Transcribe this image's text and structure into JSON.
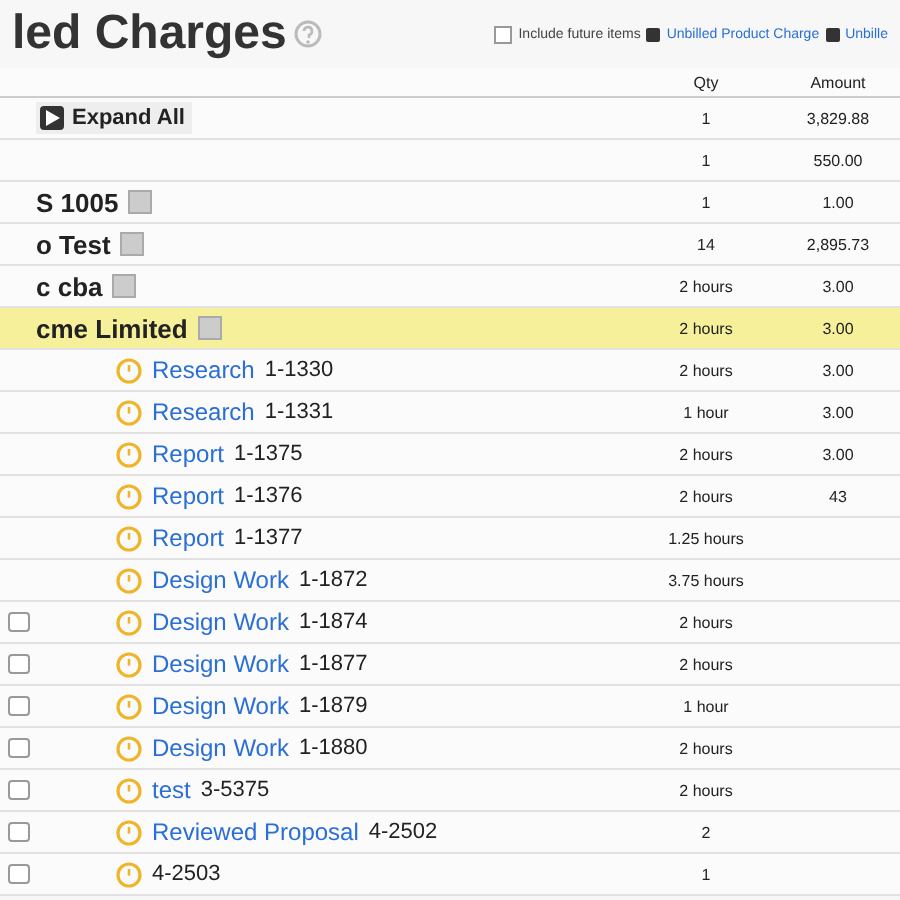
{
  "title": "led Charges",
  "toolbar": {
    "include_label": "Include future items",
    "include_checked": false,
    "link_1": "Unbilled Product Charge",
    "link_2": "Unbille"
  },
  "columns": [
    "Qty",
    "Amount"
  ],
  "expand": {
    "label": "Expand All",
    "qty": "1",
    "amount": "3,829.88"
  },
  "rows": [
    {
      "kind": "group",
      "name": "",
      "id": "",
      "qty": "1",
      "amount": "550.00",
      "selected": false
    },
    {
      "kind": "group",
      "name": "S 1005",
      "id": "",
      "qty": "1",
      "amount": "1.00",
      "selected": false
    },
    {
      "kind": "group",
      "name": "o Test",
      "id": "",
      "qty": "14",
      "amount": "2,895.73",
      "selected": false
    },
    {
      "kind": "group",
      "name": "c cba",
      "id": "",
      "qty": "2 hours",
      "amount": "3.00",
      "selected": false
    },
    {
      "kind": "group",
      "name": "cme Limited",
      "id": "",
      "qty": "2 hours",
      "amount": "3.00",
      "selected": true
    },
    {
      "kind": "task",
      "name": "Research",
      "id": "1-1330",
      "qty": "2 hours",
      "amount": "3.00",
      "selected": false
    },
    {
      "kind": "task",
      "name": "Research",
      "id": "1-1331",
      "qty": "1 hour",
      "amount": "3.00",
      "selected": false
    },
    {
      "kind": "task",
      "name": "Report",
      "id": "1-1375",
      "qty": "2 hours",
      "amount": "3.00",
      "selected": false
    },
    {
      "kind": "task",
      "name": "Report",
      "id": "1-1376",
      "qty": "2 hours",
      "amount": "43",
      "selected": false
    },
    {
      "kind": "task",
      "name": "Report",
      "id": "1-1377",
      "qty": "1.25 hours",
      "amount": "",
      "selected": false
    },
    {
      "kind": "task",
      "name": "Design Work",
      "id": "1-1872",
      "qty": "3.75 hours",
      "amount": "",
      "selected": false
    },
    {
      "kind": "task",
      "name": "Design Work",
      "id": "1-1874",
      "qty": "2 hours",
      "amount": "",
      "selected": false,
      "checkbox": false
    },
    {
      "kind": "task",
      "name": "Design Work",
      "id": "1-1877",
      "qty": "2 hours",
      "amount": "",
      "selected": false,
      "checkbox": false
    },
    {
      "kind": "task",
      "name": "Design Work",
      "id": "1-1879",
      "qty": "1 hour",
      "amount": "",
      "selected": false,
      "checkbox": false
    },
    {
      "kind": "task",
      "name": "Design Work",
      "id": "1-1880",
      "qty": "2 hours",
      "amount": "",
      "selected": false,
      "checkbox": false
    },
    {
      "kind": "task",
      "name": "test",
      "id": "3-5375",
      "qty": "2 hours",
      "amount": "",
      "selected": false,
      "checkbox": false
    },
    {
      "kind": "task",
      "name": "Reviewed Proposal",
      "id": "4-2502",
      "qty": "2",
      "amount": "",
      "selected": false,
      "checkbox": false
    },
    {
      "kind": "task",
      "name": "",
      "id": "4-2503",
      "qty": "1",
      "amount": "",
      "selected": false,
      "checkbox": false
    }
  ]
}
